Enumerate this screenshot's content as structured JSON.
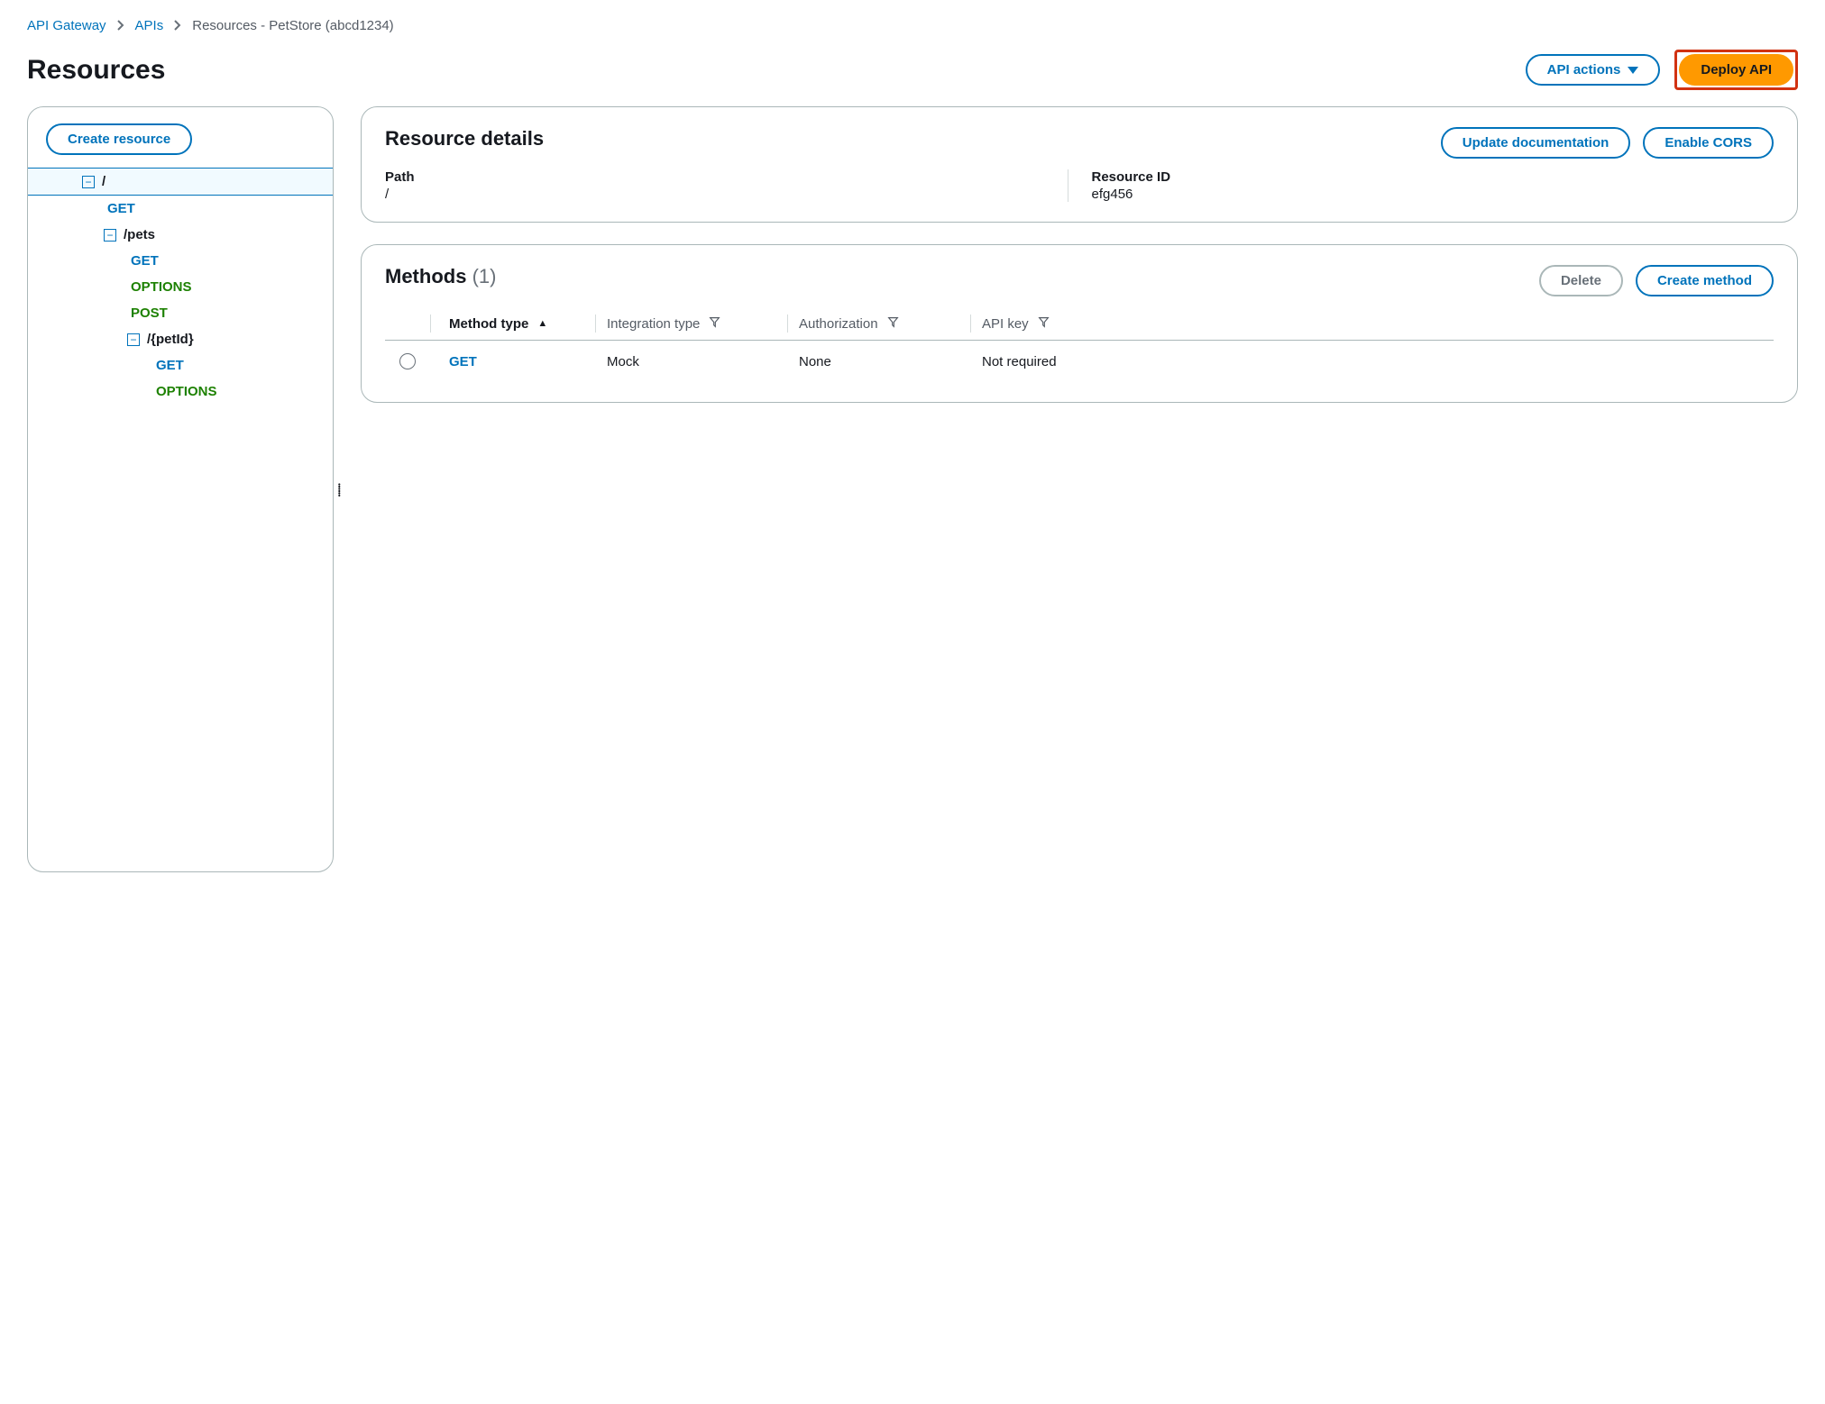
{
  "breadcrumb": {
    "root": "API Gateway",
    "apis": "APIs",
    "current": "Resources - PetStore (abcd1234)"
  },
  "page_title": "Resources",
  "header_buttons": {
    "api_actions": "API actions",
    "deploy": "Deploy API"
  },
  "sidebar": {
    "create_resource": "Create resource",
    "tree": {
      "root": "/",
      "root_get": "GET",
      "pets": "/pets",
      "pets_get": "GET",
      "pets_options": "OPTIONS",
      "pets_post": "POST",
      "petid": "/{petId}",
      "petid_get": "GET",
      "petid_options": "OPTIONS"
    }
  },
  "resource_details": {
    "title": "Resource details",
    "update_docs": "Update documentation",
    "enable_cors": "Enable CORS",
    "path_label": "Path",
    "path_value": "/",
    "id_label": "Resource ID",
    "id_value": "efg456"
  },
  "methods": {
    "title": "Methods",
    "count": "(1)",
    "delete": "Delete",
    "create": "Create method",
    "columns": {
      "method_type": "Method type",
      "integration_type": "Integration type",
      "authorization": "Authorization",
      "api_key": "API key"
    },
    "rows": [
      {
        "method": "GET",
        "integration": "Mock",
        "authorization": "None",
        "api_key": "Not required"
      }
    ]
  }
}
